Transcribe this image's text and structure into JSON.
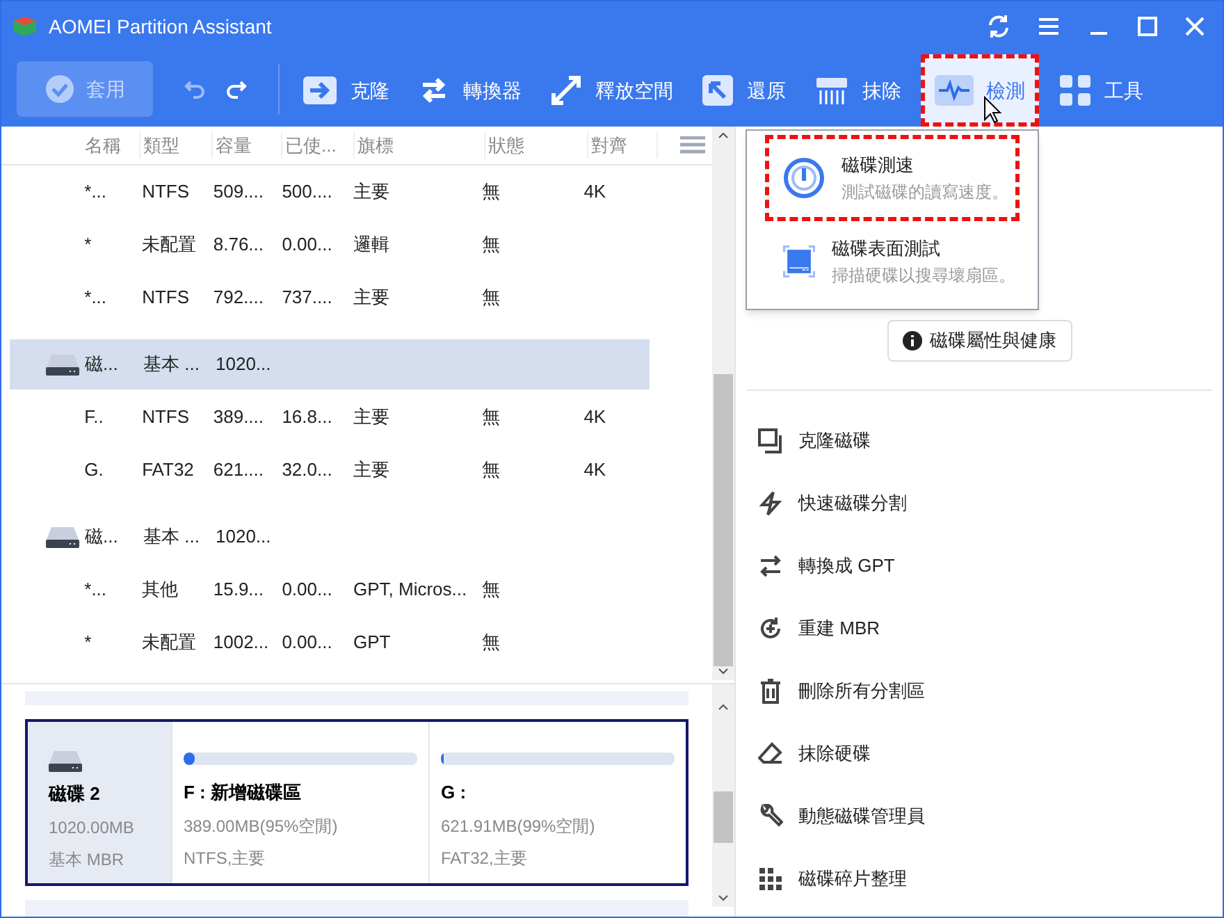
{
  "window": {
    "title": "AOMEI Partition Assistant"
  },
  "toolbar": {
    "apply": {
      "label": "套用",
      "disabled": true
    },
    "items": [
      {
        "kind": "clone",
        "label": "克隆",
        "highlighted": false
      },
      {
        "kind": "convert",
        "label": "轉換器",
        "highlighted": false
      },
      {
        "kind": "free",
        "label": "釋放空間",
        "highlighted": false
      },
      {
        "kind": "restore",
        "label": "還原",
        "highlighted": false
      },
      {
        "kind": "wipe",
        "label": "抹除",
        "highlighted": false
      },
      {
        "kind": "test",
        "label": "檢測",
        "highlighted": true
      },
      {
        "kind": "tools",
        "label": "工具",
        "highlighted": false
      }
    ]
  },
  "table": {
    "columns": [
      "名稱",
      "類型",
      "容量",
      "已使...",
      "旗標",
      "狀態",
      "對齊"
    ],
    "rows": [
      {
        "kind": "partition",
        "selected": false,
        "cells": [
          "*...",
          "NTFS",
          "509....",
          "500....",
          "主要",
          "無",
          "4K"
        ]
      },
      {
        "kind": "partition",
        "selected": false,
        "cells": [
          "*",
          "未配置",
          "8.76...",
          "0.00...",
          "邏輯",
          "無",
          ""
        ]
      },
      {
        "kind": "partition",
        "selected": false,
        "cells": [
          "*...",
          "NTFS",
          "792....",
          "737....",
          "主要",
          "無",
          ""
        ]
      },
      {
        "kind": "disk",
        "selected": true,
        "cells": [
          "磁...",
          "基本 ...",
          "1020..."
        ]
      },
      {
        "kind": "partition",
        "selected": false,
        "cells": [
          "F..",
          "NTFS",
          "389....",
          "16.8...",
          "主要",
          "無",
          "4K"
        ]
      },
      {
        "kind": "partition",
        "selected": false,
        "cells": [
          "G.",
          "FAT32",
          "621....",
          "32.0...",
          "主要",
          "無",
          "4K"
        ]
      },
      {
        "kind": "disk",
        "selected": false,
        "cells": [
          "磁...",
          "基本 ...",
          "1020..."
        ]
      },
      {
        "kind": "partition",
        "selected": false,
        "cells": [
          "*...",
          "其他",
          "15.9...",
          "0.00...",
          "GPT, Micros...",
          "無",
          ""
        ]
      },
      {
        "kind": "partition",
        "selected": false,
        "cells": [
          "*",
          "未配置",
          "1002...",
          "0.00...",
          "GPT",
          "無",
          ""
        ]
      }
    ]
  },
  "disk_card": {
    "name": "磁碟 2",
    "size": "1020.00MB",
    "type": "基本 MBR",
    "partitions": [
      {
        "label": "F : 新增磁碟區",
        "space": "389.00MB(95%空閒)",
        "info": "NTFS,主要",
        "level": 0.05
      },
      {
        "label": "G :",
        "space": "621.91MB(99%空閒)",
        "info": "FAT32,主要",
        "level": 0.01
      }
    ]
  },
  "dropdown": {
    "items": [
      {
        "kind": "speed",
        "title": "磁碟測速",
        "description": "測試磁碟的讀寫速度。",
        "highlighted": true
      },
      {
        "kind": "surface",
        "title": "磁碟表面測試",
        "description": "掃描硬碟以搜尋壞扇區。",
        "highlighted": false
      }
    ]
  },
  "properties_button": {
    "label": "磁碟屬性與健康"
  },
  "actions": [
    {
      "kind": "clone",
      "label": "克隆磁碟"
    },
    {
      "kind": "quick",
      "label": "快速磁碟分割"
    },
    {
      "kind": "convert",
      "label": "轉換成 GPT"
    },
    {
      "kind": "rebuild",
      "label": "重建 MBR"
    },
    {
      "kind": "delete",
      "label": "刪除所有分割區"
    },
    {
      "kind": "wipe",
      "label": "抹除硬碟"
    },
    {
      "kind": "dynamic",
      "label": "動態磁碟管理員"
    },
    {
      "kind": "defrag",
      "label": "磁碟碎片整理"
    }
  ]
}
